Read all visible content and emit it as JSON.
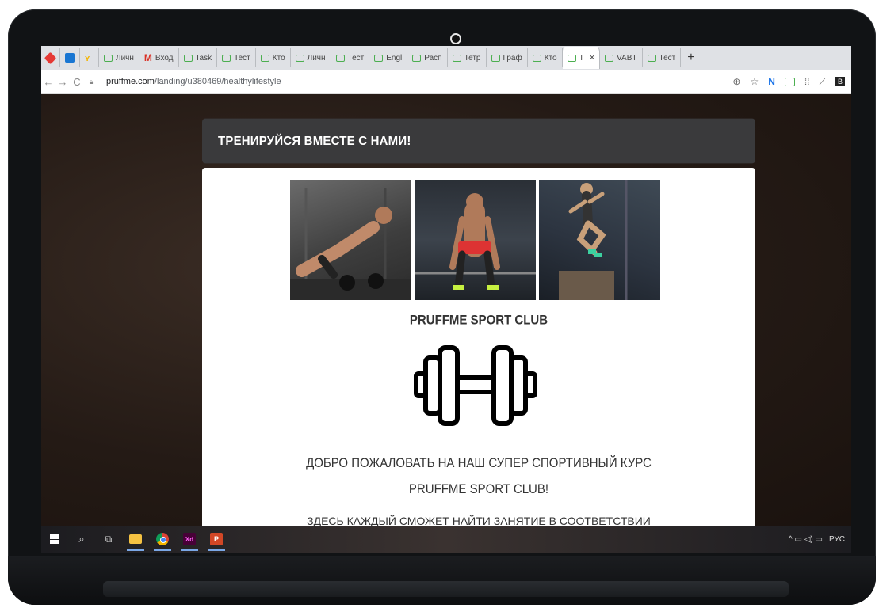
{
  "browser": {
    "tabs": [
      {
        "label": "",
        "icon": "red-diamond-icon"
      },
      {
        "label": "",
        "icon": "trello-icon"
      },
      {
        "label": "",
        "icon": "yandex-icon"
      },
      {
        "label": "Личн",
        "icon": "page-icon"
      },
      {
        "label": "Вход",
        "icon": "gmail-icon"
      },
      {
        "label": "Task",
        "icon": "page-icon"
      },
      {
        "label": "Тест",
        "icon": "page-icon"
      },
      {
        "label": "Кто",
        "icon": "page-icon"
      },
      {
        "label": "Личн",
        "icon": "page-icon"
      },
      {
        "label": "Тест",
        "icon": "page-icon"
      },
      {
        "label": "Engl",
        "icon": "page-icon"
      },
      {
        "label": "Расп",
        "icon": "page-icon"
      },
      {
        "label": "Тетр",
        "icon": "page-icon"
      },
      {
        "label": "Граф",
        "icon": "page-icon"
      },
      {
        "label": "Кто",
        "icon": "page-icon"
      },
      {
        "label": "Т",
        "icon": "page-icon",
        "active": true,
        "close": "×"
      },
      {
        "label": "VABT",
        "icon": "page-icon"
      },
      {
        "label": "Тест",
        "icon": "page-icon"
      }
    ],
    "new_tab": "+",
    "nav": {
      "back": "←",
      "forward": "→",
      "reload": "C"
    },
    "url_host": "pruffme.com",
    "url_path": "/landing/u380469/healthylifestyle",
    "addr_icons": {
      "zoom": "⊕",
      "star": "☆"
    }
  },
  "page": {
    "header": "ТРЕНИРУЙСЯ ВМЕСТЕ С НАМИ!",
    "club_title": "PRUFFME SPORT CLUB",
    "welcome_line1": "ДОБРО ПОЖАЛОВАТЬ НА НАШ СУПЕР СПОРТИВНЫЙ КУРС",
    "welcome_line2": "PRUFFME SPORT CLUB!",
    "cut_text": "ЗДЕСЬ КАЖДЫЙ СМОЖЕТ НАЙТИ ЗАНЯТИЕ В СООТВЕТСТВИИ"
  },
  "taskbar": {
    "tray_text": "РУС",
    "tray_symbols": "^ ▭ ◁) ▭"
  }
}
